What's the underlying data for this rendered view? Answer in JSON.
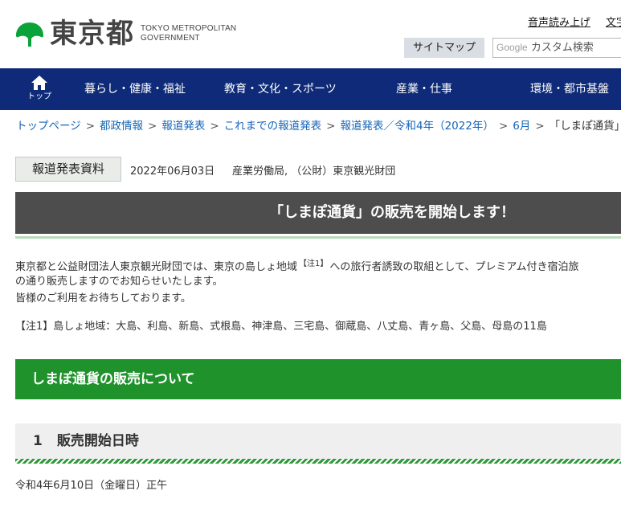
{
  "header": {
    "logo_jp": "東京都",
    "logo_en_line1": "TOKYO METROPOLITAN",
    "logo_en_line2": "GOVERNMENT",
    "util_links": [
      "音声読み上げ",
      "文字"
    ],
    "sitemap_label": "サイトマップ",
    "search_brand": "Google",
    "search_placeholder": "カスタム検索"
  },
  "nav": {
    "home_label": "トップ",
    "items": [
      "暮らし・健康・福祉",
      "教育・文化・スポーツ",
      "産業・仕事",
      "環境・都市基盤"
    ]
  },
  "breadcrumb": {
    "items": [
      "トップページ",
      "都政情報",
      "報道発表",
      "これまでの報道発表",
      "報道発表／令和4年（2022年）",
      "6月",
      "「しまぽ通貨」"
    ],
    "separator": ">"
  },
  "press": {
    "label": "報道発表資料",
    "date": "2022年06月03日",
    "org": "産業労働局, （公財）東京観光財団"
  },
  "article": {
    "title": "「しまぽ通貨」の販売を開始します！",
    "para1_a": "東京都と公益財団法人東京観光財団では、東京の島しょ地域",
    "para1_note": "【注1】",
    "para1_b": "への旅行者誘致の取組として、プレミアム付き宿泊旅",
    "para2": "の通り販売しますのでお知らせいたします。",
    "para3": "皆様のご利用をお待ちしております。",
    "note": "【注1】島しょ地域：大島、利島、新島、式根島、神津島、三宅島、御蔵島、八丈島、青ヶ島、父島、母島の11島",
    "section_title": "しまぽ通貨の販売について",
    "sub_number": "1",
    "sub_title": "販売開始日時",
    "sub_body": "令和4年6月10日（金曜日）正午"
  },
  "colors": {
    "nav_bg": "#0e2a78",
    "title_bg": "#4d4d4d",
    "section_bg": "#1f922c",
    "link": "#1565b8",
    "logo_green": "#0aa33a"
  }
}
